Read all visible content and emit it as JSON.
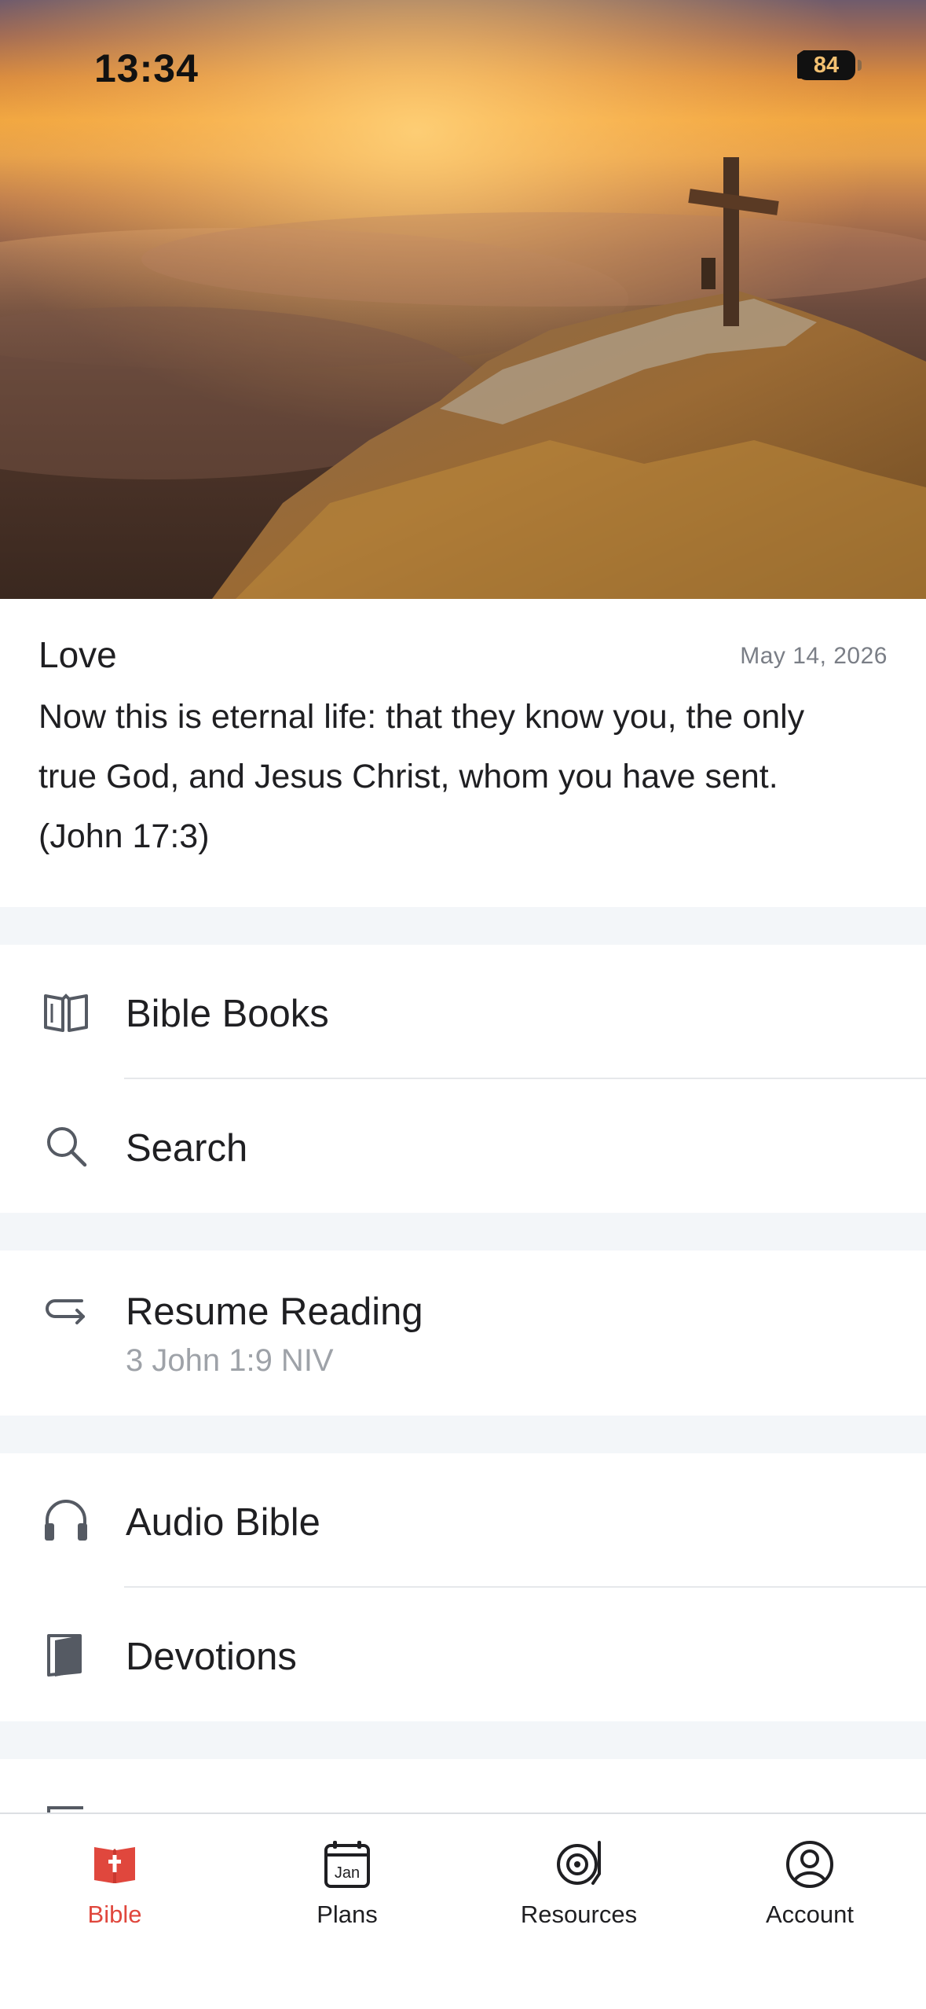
{
  "status_bar": {
    "time": "13:34",
    "battery": "84"
  },
  "verse_of_day": {
    "title": "Love",
    "date": "May 14, 2026",
    "text": "Now this is eternal life: that they know you, the only true God, and Jesus Christ, whom you have sent. (John 17:3)"
  },
  "menu": {
    "bible_books": {
      "label": "Bible Books",
      "icon": "open-book-icon"
    },
    "search": {
      "label": "Search",
      "icon": "search-icon"
    },
    "resume_reading": {
      "label": "Resume Reading",
      "sub": "3 John 1:9 NIV",
      "icon": "return-arrow-icon"
    },
    "audio_bible": {
      "label": "Audio Bible",
      "icon": "headphones-icon"
    },
    "devotions": {
      "label": "Devotions",
      "icon": "devotion-book-icon"
    }
  },
  "tabbar": {
    "tabs": [
      {
        "label": "Bible",
        "icon": "bible-icon",
        "active": true
      },
      {
        "label": "Plans",
        "icon": "calendar-icon",
        "calendar_text": "Jan"
      },
      {
        "label": "Resources",
        "icon": "record-player-icon"
      },
      {
        "label": "Account",
        "icon": "account-icon"
      }
    ]
  },
  "colors": {
    "accent": "#e0473d",
    "separator": "#f3f6f9",
    "muted_text": "#9ea2a8"
  }
}
